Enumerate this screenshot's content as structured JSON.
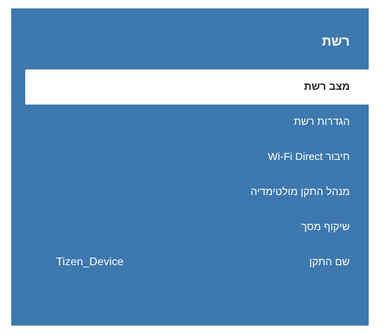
{
  "panel": {
    "title": "רשת",
    "background": "#3d78ae"
  },
  "menu": {
    "items": [
      {
        "label": "מצב רשת",
        "selected": true
      },
      {
        "label": "הגדרות רשת"
      },
      {
        "label": "חיבור Wi-Fi Direct"
      },
      {
        "label": "מנהל התקן מולטימדיה"
      },
      {
        "label": "שיקוף מסך"
      },
      {
        "label": "שם התקן",
        "value": "Tizen_Device"
      }
    ]
  }
}
